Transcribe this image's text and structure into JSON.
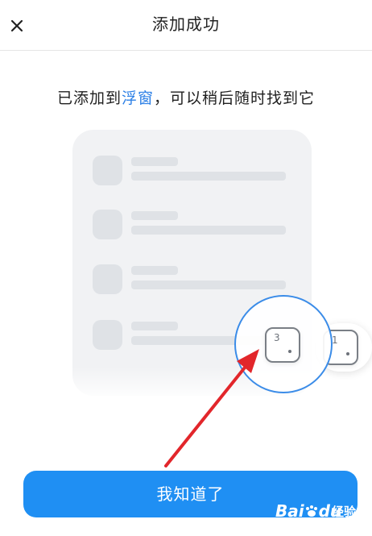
{
  "header": {
    "title": "添加成功",
    "close_icon": "close-icon"
  },
  "message": {
    "prefix": "已添加到",
    "highlight": "浮窗",
    "suffix": "，可以稍后随时找到它",
    "highlight_color": "#2b7fe6"
  },
  "illustration": {
    "rows": 4,
    "floating_window_current_number": "3",
    "floating_window_other_number": "1",
    "accent_color": "#3b8ce8"
  },
  "primary_button": {
    "label": "我知道了",
    "color": "#1f8ff3"
  },
  "annotation": {
    "arrow_color": "#e2262b"
  },
  "watermark": {
    "brand": "Bai",
    "paw": "paw-icon",
    "brand_suffix": "du",
    "label": "经验"
  }
}
